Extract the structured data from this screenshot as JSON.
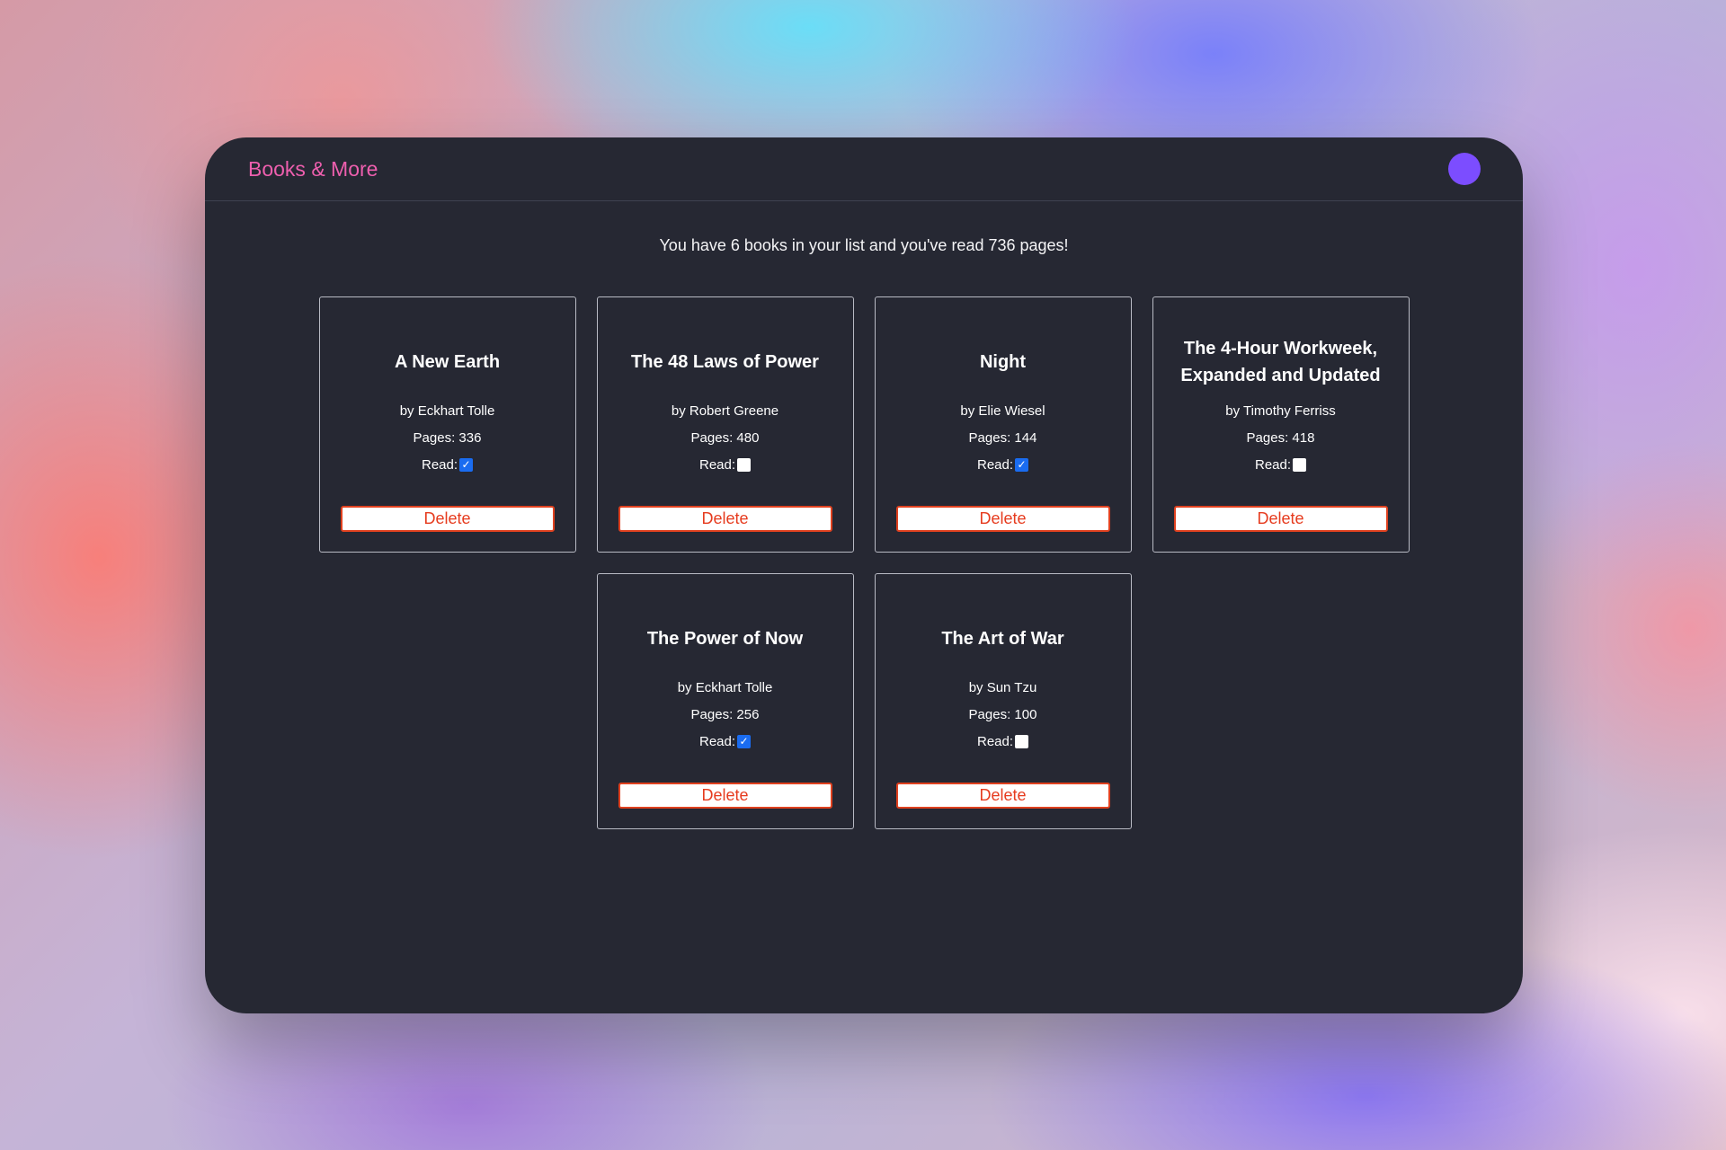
{
  "header": {
    "brand": "Books & More"
  },
  "summary": "You have 6 books in your list and you've read 736 pages!",
  "read_label": "Read:",
  "delete_label": "Delete",
  "check_glyph": "✓",
  "books": [
    {
      "title": "A New Earth",
      "author": "by Eckhart Tolle",
      "pages": "Pages: 336",
      "read": true
    },
    {
      "title": "The 48 Laws of Power",
      "author": "by Robert Greene",
      "pages": "Pages: 480",
      "read": false
    },
    {
      "title": "Night",
      "author": "by Elie Wiesel",
      "pages": "Pages: 144",
      "read": true
    },
    {
      "title": "The 4-Hour Workweek, Expanded and Updated",
      "author": "by Timothy Ferriss",
      "pages": "Pages: 418",
      "read": false
    },
    {
      "title": "The Power of Now",
      "author": "by Eckhart Tolle",
      "pages": "Pages: 256",
      "read": true
    },
    {
      "title": "The Art of War",
      "author": "by Sun Tzu",
      "pages": "Pages: 100",
      "read": false
    }
  ],
  "colors": {
    "brand": "#ee5fae",
    "avatar": "#7c4dff",
    "checkbox_checked": "#1a6cf0",
    "delete_text": "#e63b1e",
    "window_bg": "#262833"
  }
}
